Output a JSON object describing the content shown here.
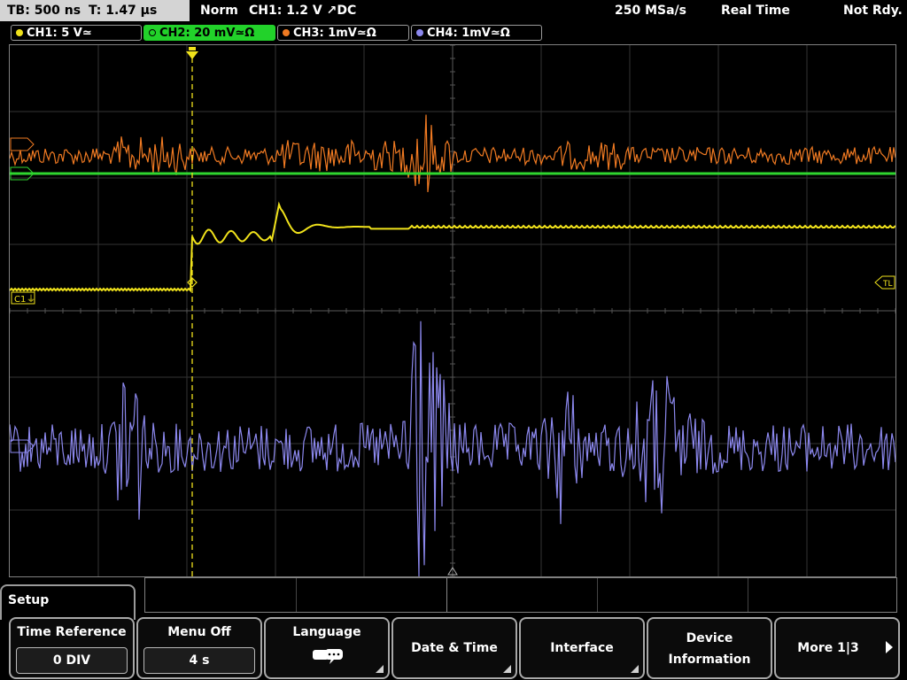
{
  "status_bar": {
    "timebase": "TB: 500 ns",
    "trigger_time": "T: 1.47 μs",
    "trigger_mode": "Norm",
    "trigger_info": "CH1: 1.2 V ↗DC",
    "sample_rate": "250 MSa/s",
    "acq_mode": "Real Time",
    "state": "Not Rdy."
  },
  "channels": [
    {
      "label": "CH1: 5 V≃",
      "color": "#f0e21b",
      "active": false
    },
    {
      "label": "CH2: 20 mV≃Ω",
      "color": "#2fd62f",
      "active": true
    },
    {
      "label": "CH3: 1mV≃Ω",
      "color": "#f07a22",
      "active": false
    },
    {
      "label": "CH4: 1mV≃Ω",
      "color": "#8c88ee",
      "active": false
    }
  ],
  "screen_markers": {
    "c1_label": "C1",
    "trigger_level_label": "TL"
  },
  "menu": {
    "title": "Setup",
    "softkeys": [
      {
        "label": "Time Reference",
        "value": "0 DIV"
      },
      {
        "label": "Menu Off",
        "value": "4 s"
      },
      {
        "label": "Language",
        "icon": "speech-bubble-icon"
      },
      {
        "label": "Date & Time"
      },
      {
        "label": "Interface"
      },
      {
        "label_line1": "Device",
        "label_line2": "Information"
      },
      {
        "label": "More 1|3"
      }
    ]
  }
}
